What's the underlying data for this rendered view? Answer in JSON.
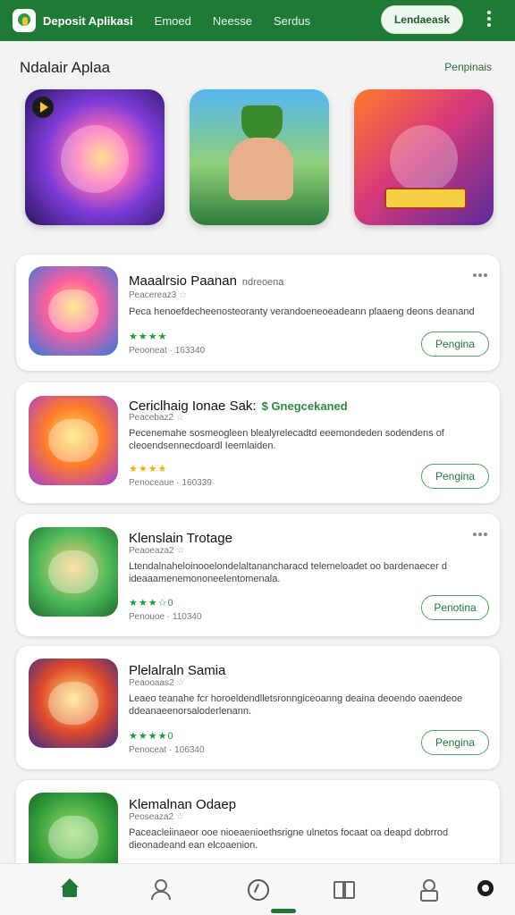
{
  "header": {
    "brand": "Deposit Aplikasi",
    "nav": [
      "Emoed",
      "Neesse",
      "Serdus"
    ],
    "cta": "Lendaeask"
  },
  "section": {
    "title": "Ndalair Aplaa",
    "more": "Penpinais"
  },
  "apps": [
    {
      "title": "Maaalrsio Paanan",
      "tag": "ndreoena",
      "sub": "Peacereaz3",
      "desc": "Peca henoefdecheenosteoranty verandoeneoeadeann plaaeng deons deanand",
      "rating": "★★★★",
      "rating_color": "g",
      "meta": "Peooneat · 163340",
      "install": "Pengina"
    },
    {
      "title": "Cericlhaig Ionae Sak:",
      "tag": "$ Gnegcekaned",
      "sub": "Peacebaz2",
      "desc": "Pecenemahe sosmeogleen blealyrelecadtd eeemondeden sodendens of cleoendsennecdoardl Ieemlaiden.",
      "rating": "★★★★",
      "rating_color": "y",
      "meta": "Penoceaue · 160339",
      "install": "Pengina"
    },
    {
      "title": "Klenslain Trotage",
      "tag": "",
      "sub": "Peaoeaza2",
      "desc": "Ltendalnaheloinooelondelaltanancharacd telemeloadet oo bardenaecer d ideaaamenemononeelentomenala.",
      "rating": "★★★☆0",
      "rating_color": "g",
      "meta": "Penouoe · 110340",
      "install": "Penotina"
    },
    {
      "title": "Plelalraln Samia",
      "tag": "",
      "sub": "Peaooaas2",
      "desc": "Leaeo teanahe fcr horoeldendlletsronngiceoanng deaina deoendo oaendeoe ddeanaeenorsaloderlenann.",
      "rating": "★★★★0",
      "rating_color": "g",
      "meta": "Penoceat · 106340",
      "install": "Pengina"
    },
    {
      "title": "Klemalnan Odaep",
      "tag": "",
      "sub": "Peoseaza2",
      "desc": "Paceacleiinaeor ooe nioeaenioethsrigne ulnetos focaat oa deapd dobrrod dieonadeand ean elcoaenion.",
      "rating": "",
      "rating_color": "g",
      "meta": "",
      "install": ""
    }
  ]
}
